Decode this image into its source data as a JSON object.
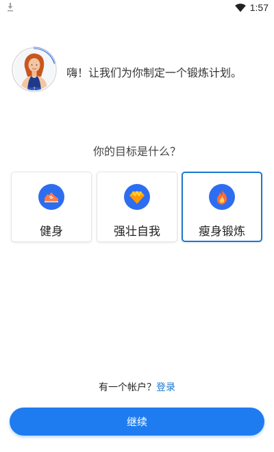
{
  "status_bar": {
    "time": "1:57",
    "left_icon": "download-icon",
    "wifi_icon": "wifi-icon",
    "battery_icon": "battery-icon"
  },
  "header": {
    "coach_avatar": "coach-avatar",
    "greeting": "嗨！让我们为你制定一个锻炼计划。"
  },
  "main": {
    "question": "你的目标是什么？",
    "goals": [
      {
        "label": "健身",
        "icon": "sneaker-icon",
        "selected": false
      },
      {
        "label": "强壮自我",
        "icon": "diamond-icon",
        "selected": false
      },
      {
        "label": "瘦身锻炼",
        "icon": "flame-icon",
        "selected": true
      }
    ]
  },
  "footer": {
    "account_prompt": "有一个帐户？",
    "login_label": "登录",
    "continue_label": "继续"
  },
  "colors": {
    "accent": "#1976d2",
    "button": "#1e7cf0",
    "icon_bg": "#2d6df0"
  }
}
